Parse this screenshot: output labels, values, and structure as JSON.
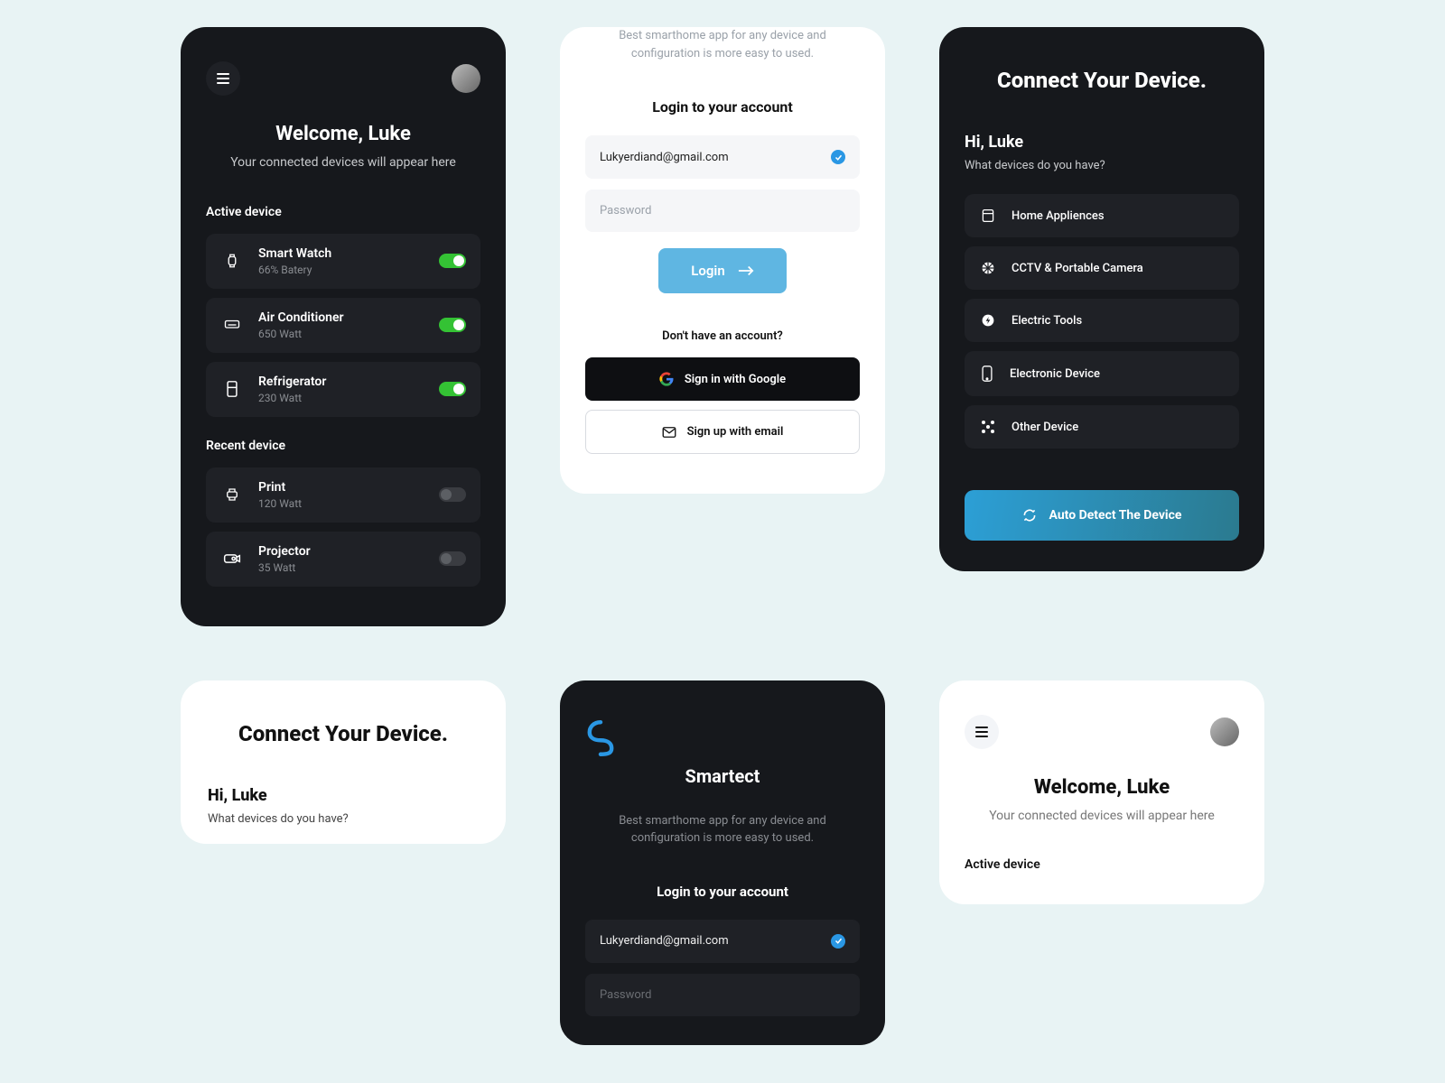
{
  "card1": {
    "welcome": "Welcome, Luke",
    "subtitle": "Your connected devices will appear here",
    "active_label": "Active device",
    "recent_label": "Recent device",
    "devices_active": [
      {
        "name": "Smart Watch",
        "sub": "66% Batery",
        "on": true
      },
      {
        "name": "Air Conditioner",
        "sub": "650 Watt",
        "on": true
      },
      {
        "name": "Refrigerator",
        "sub": "230 Watt",
        "on": true
      }
    ],
    "devices_recent": [
      {
        "name": "Print",
        "sub": "120 Watt",
        "on": false
      },
      {
        "name": "Projector",
        "sub": "35 Watt",
        "on": false
      }
    ]
  },
  "card2": {
    "tagline": "Best smarthome app for any device and configuration is more easy to used.",
    "login_heading": "Login to your account",
    "email_value": "Lukyerdiand@gmail.com",
    "password_placeholder": "Password",
    "login_btn": "Login",
    "no_account": "Don't have an account?",
    "google_btn": "Sign in with Google",
    "email_btn": "Sign up with email"
  },
  "card3": {
    "title": "Connect Your Device.",
    "hi": "Hi, Luke",
    "question": "What devices do you have?",
    "categories": [
      "Home Appliences",
      "CCTV & Portable Camera",
      "Electric Tools",
      "Electronic Device",
      "Other Device"
    ],
    "auto": "Auto Detect The Device"
  },
  "card4": {
    "title": "Connect Your Device.",
    "hi": "Hi, Luke",
    "question": "What devices do you have?"
  },
  "card5": {
    "brand": "Smartect",
    "tagline": "Best smarthome app for any device and configuration is more easy to used.",
    "login_heading": "Login to your account",
    "email_value": "Lukyerdiand@gmail.com",
    "password_placeholder": "Password"
  },
  "card6": {
    "welcome": "Welcome, Luke",
    "subtitle": "Your connected devices will appear here",
    "active_label": "Active device"
  }
}
